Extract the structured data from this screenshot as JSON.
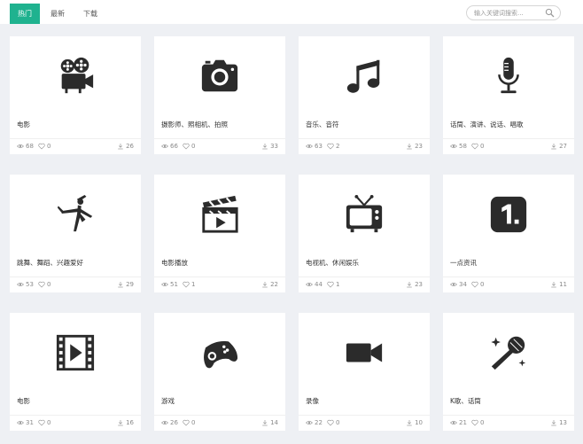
{
  "tabs": [
    {
      "label": "热门",
      "active": true
    },
    {
      "label": "最新",
      "active": false
    },
    {
      "label": "下载",
      "active": false
    }
  ],
  "search": {
    "placeholder": "输入关键词搜索..."
  },
  "accent_color": "#1fb28f",
  "icon_color": "#2b2b2b",
  "cards": [
    {
      "icon": "film-projector-icon",
      "title": "电影",
      "views": "68",
      "likes": "0",
      "downloads": "26"
    },
    {
      "icon": "camera-icon",
      "title": "摄影师、照相机、拍照",
      "views": "66",
      "likes": "0",
      "downloads": "33"
    },
    {
      "icon": "music-note-icon",
      "title": "音乐、音符",
      "views": "63",
      "likes": "2",
      "downloads": "23"
    },
    {
      "icon": "microphone-icon",
      "title": "话筒、演讲、说话、唱歌",
      "views": "58",
      "likes": "0",
      "downloads": "27"
    },
    {
      "icon": "dancer-icon",
      "title": "跳舞、舞蹈、兴趣爱好",
      "views": "53",
      "likes": "0",
      "downloads": "29"
    },
    {
      "icon": "clapperboard-icon",
      "title": "电影播放",
      "views": "51",
      "likes": "1",
      "downloads": "22"
    },
    {
      "icon": "television-icon",
      "title": "电视机、休闲娱乐",
      "views": "44",
      "likes": "1",
      "downloads": "23"
    },
    {
      "icon": "number-one-icon",
      "title": "一点资讯",
      "views": "34",
      "likes": "0",
      "downloads": "11"
    },
    {
      "icon": "film-play-icon",
      "title": "电影",
      "views": "31",
      "likes": "0",
      "downloads": "16"
    },
    {
      "icon": "gamepad-icon",
      "title": "游戏",
      "views": "26",
      "likes": "0",
      "downloads": "14"
    },
    {
      "icon": "video-camera-icon",
      "title": "录像",
      "views": "22",
      "likes": "0",
      "downloads": "10"
    },
    {
      "icon": "karaoke-mic-icon",
      "title": "K歌、话筒",
      "views": "21",
      "likes": "0",
      "downloads": "13"
    }
  ]
}
